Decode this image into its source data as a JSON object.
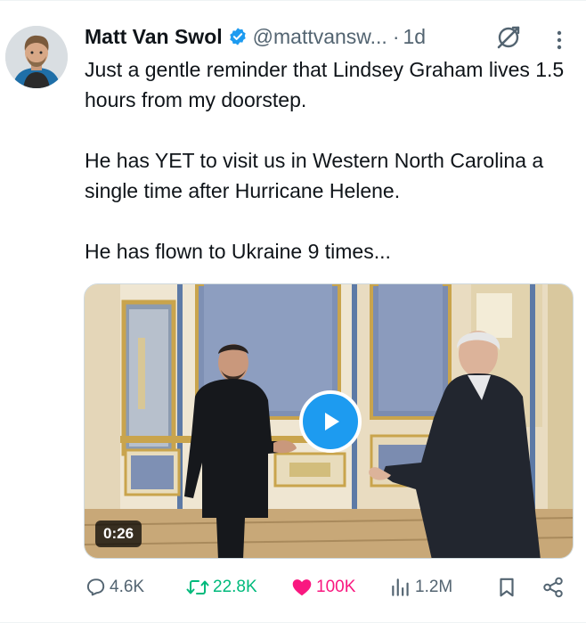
{
  "author": {
    "display_name": "Matt Van Swol",
    "handle": "@mattvansw...",
    "separator": "·",
    "time": "1d",
    "verified": true
  },
  "tweet": {
    "paragraphs": [
      "Just a gentle reminder that Lindsey Graham lives 1.5 hours from my doorstep.",
      "He has YET to visit us in Western North Carolina a single time after Hurricane Helene.",
      "He has flown to Ukraine 9 times..."
    ]
  },
  "media": {
    "type": "video",
    "duration": "0:26"
  },
  "actions": {
    "reply_count": "4.6K",
    "retweet_count": "22.8K",
    "like_count": "100K",
    "view_count": "1.2M",
    "liked": true,
    "retweeted": true
  },
  "colors": {
    "accent": "#1d9bf0",
    "retweet_green": "#00ba7c",
    "like_pink": "#f91880",
    "muted": "#536471",
    "text": "#0f1419"
  },
  "icons": {
    "verified": "verified-badge-icon",
    "grok": "grok-icon",
    "more": "more-vertical-icon",
    "reply": "reply-icon",
    "retweet": "retweet-icon",
    "like": "heart-icon",
    "views": "views-icon",
    "bookmark": "bookmark-icon",
    "share": "share-icon",
    "play": "play-icon"
  }
}
